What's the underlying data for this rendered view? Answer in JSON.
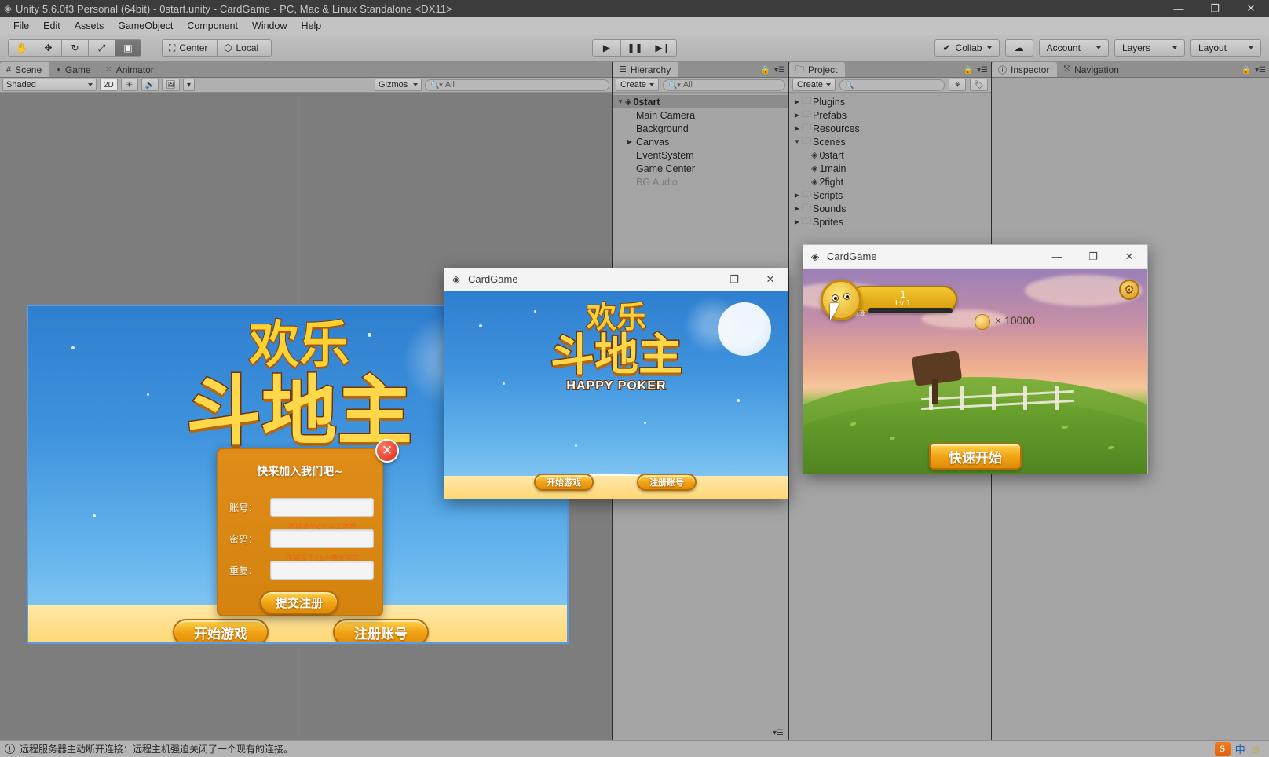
{
  "window": {
    "title": "Unity 5.6.0f3 Personal (64bit) - 0start.unity - CardGame - PC, Mac & Linux Standalone <DX11>",
    "logo_icon": "unity-logo-icon",
    "minimize_icon": "minimize-icon",
    "maximize_icon": "maximize-icon",
    "close_icon": "close-icon"
  },
  "menubar": {
    "items": [
      {
        "label": "File"
      },
      {
        "label": "Edit"
      },
      {
        "label": "Assets"
      },
      {
        "label": "GameObject"
      },
      {
        "label": "Component"
      },
      {
        "label": "Window"
      },
      {
        "label": "Help"
      }
    ]
  },
  "toolbar": {
    "transform_tools": [
      {
        "name": "hand-tool",
        "icon": "✋",
        "active": false
      },
      {
        "name": "move-tool",
        "icon": "✥",
        "active": false
      },
      {
        "name": "rotate-tool",
        "icon": "↻",
        "active": false
      },
      {
        "name": "scale-tool",
        "icon": "⤢",
        "active": false
      },
      {
        "name": "rect-tool",
        "icon": "◫",
        "active": true
      }
    ],
    "pivot_label": "Center",
    "pivot_icon": "pivot-center-icon",
    "space_label": "Local",
    "space_icon": "local-space-icon",
    "play_icon": "play-icon",
    "pause_icon": "pause-icon",
    "step_icon": "step-icon",
    "collab_label": "Collab",
    "collab_icon": "collab-check-icon",
    "cloud_icon": "cloud-icon",
    "account_label": "Account",
    "layers_label": "Layers",
    "layout_label": "Layout"
  },
  "scene_panel": {
    "tabs": [
      {
        "label": "Scene",
        "icon": "scene-grid-icon",
        "active": true
      },
      {
        "label": "Game",
        "icon": "game-pad-icon",
        "active": false
      },
      {
        "label": "Animator",
        "icon": "animator-icon",
        "active": false
      }
    ],
    "shading_mode": "Shaded",
    "mode_2d": "2D",
    "lighting_icon": "lighting-icon",
    "audio_icon": "audio-icon",
    "effects_icon": "effects-image-icon",
    "gizmos_label": "Gizmos",
    "search_placeholder": "All"
  },
  "hierarchy": {
    "tab_label": "Hierarchy",
    "tab_icon": "hierarchy-icon",
    "create_label": "Create",
    "search_placeholder": "All",
    "lock_icon": "lock-icon",
    "menu_icon": "panel-menu-icon",
    "items": [
      {
        "label": "0start",
        "depth": 0,
        "twisty": "down",
        "icon": "unity-scene-icon",
        "bold": true,
        "dim": false
      },
      {
        "label": "Main Camera",
        "depth": 1,
        "twisty": "none",
        "icon": "",
        "bold": false,
        "dim": false
      },
      {
        "label": "Background",
        "depth": 1,
        "twisty": "none",
        "icon": "",
        "bold": false,
        "dim": false
      },
      {
        "label": "Canvas",
        "depth": 1,
        "twisty": "right",
        "icon": "",
        "bold": false,
        "dim": false
      },
      {
        "label": "EventSystem",
        "depth": 1,
        "twisty": "none",
        "icon": "",
        "bold": false,
        "dim": false
      },
      {
        "label": "Game Center",
        "depth": 1,
        "twisty": "none",
        "icon": "",
        "bold": false,
        "dim": false
      },
      {
        "label": "BG Audio",
        "depth": 1,
        "twisty": "none",
        "icon": "",
        "bold": false,
        "dim": true
      }
    ]
  },
  "project": {
    "tab_label": "Project",
    "tab_icon": "folder-icon",
    "create_label": "Create",
    "search_placeholder": "",
    "filter_icon": "filter-type-icon",
    "label_icon": "label-tag-icon",
    "lock_icon": "lock-icon",
    "items": [
      {
        "label": "Plugins",
        "depth": 0,
        "twisty": "right",
        "icon": "folder-icon"
      },
      {
        "label": "Prefabs",
        "depth": 0,
        "twisty": "right",
        "icon": "folder-icon"
      },
      {
        "label": "Resources",
        "depth": 0,
        "twisty": "right",
        "icon": "folder-icon"
      },
      {
        "label": "Scenes",
        "depth": 0,
        "twisty": "down",
        "icon": "folder-icon"
      },
      {
        "label": "0start",
        "depth": 1,
        "twisty": "none",
        "icon": "unity-scene-icon"
      },
      {
        "label": "1main",
        "depth": 1,
        "twisty": "none",
        "icon": "unity-scene-icon"
      },
      {
        "label": "2fight",
        "depth": 1,
        "twisty": "none",
        "icon": "unity-scene-icon"
      },
      {
        "label": "Scripts",
        "depth": 0,
        "twisty": "right",
        "icon": "folder-icon"
      },
      {
        "label": "Sounds",
        "depth": 0,
        "twisty": "right",
        "icon": "folder-icon"
      },
      {
        "label": "Sprites",
        "depth": 0,
        "twisty": "right",
        "icon": "folder-icon"
      }
    ]
  },
  "inspector": {
    "tabs": [
      {
        "label": "Inspector",
        "icon": "inspector-info-icon",
        "active": true
      },
      {
        "label": "Navigation",
        "icon": "navigation-icon",
        "active": false
      }
    ],
    "lock_icon": "lock-icon",
    "menu_icon": "panel-menu-icon"
  },
  "scene_game": {
    "logo_top": "欢乐",
    "logo_main": "斗地主",
    "logo_sub": "HAPPY POKER",
    "start_button": "开始游戏",
    "register_button": "注册账号",
    "dialog": {
      "title": "快来加入我们吧~",
      "close_icon": "close-circle-icon",
      "fields": [
        {
          "label": "账号：",
          "value": "",
          "hint": "不能多于6个中文字符"
        },
        {
          "label": "密码：",
          "value": "",
          "hint": "不能多于16个英文字符"
        },
        {
          "label": "重复：",
          "value": "",
          "hint": ""
        }
      ],
      "submit_button": "提交注册"
    }
  },
  "game_window_login": {
    "title": "CardGame",
    "logo_icon": "unity-logo-icon",
    "minimize_icon": "minimize-icon",
    "maximize_icon": "maximize-icon",
    "close_icon": "close-icon",
    "logo_top": "欢乐",
    "logo_main": "斗地主",
    "logo_sub": "HAPPY POKER",
    "start_button": "开始游戏",
    "register_button": "注册账号"
  },
  "game_window_lobby": {
    "title": "CardGame",
    "logo_icon": "unity-logo-icon",
    "minimize_icon": "minimize-icon",
    "maximize_icon": "maximize-icon",
    "close_icon": "close-icon",
    "player_name": "1",
    "player_level": "Lv.1",
    "exp_label": "经验",
    "coin_icon": "coin-icon",
    "coin_amount": "× 10000",
    "settings_icon": "gear-icon",
    "quick_start_button": "快速开始",
    "avatar_icon": "avatar-icon",
    "cursor_icon": "cursor-arrow-icon"
  },
  "statusbar": {
    "warning_icon": "warning-icon",
    "message": "远程服务器主动断开连接：远程主机强迫关闭了一个现有的连接。",
    "tray": {
      "ime_logo": "S",
      "ime_mode": "中",
      "ime_smiley": "☺"
    }
  },
  "colors": {
    "accent_orange": "#e08c18",
    "unity_chrome": "#c0c0c0",
    "panel_bg": "#a5a5a5",
    "scene_bg": "#7d7d7d",
    "titlebar": "#3c3c3c"
  }
}
